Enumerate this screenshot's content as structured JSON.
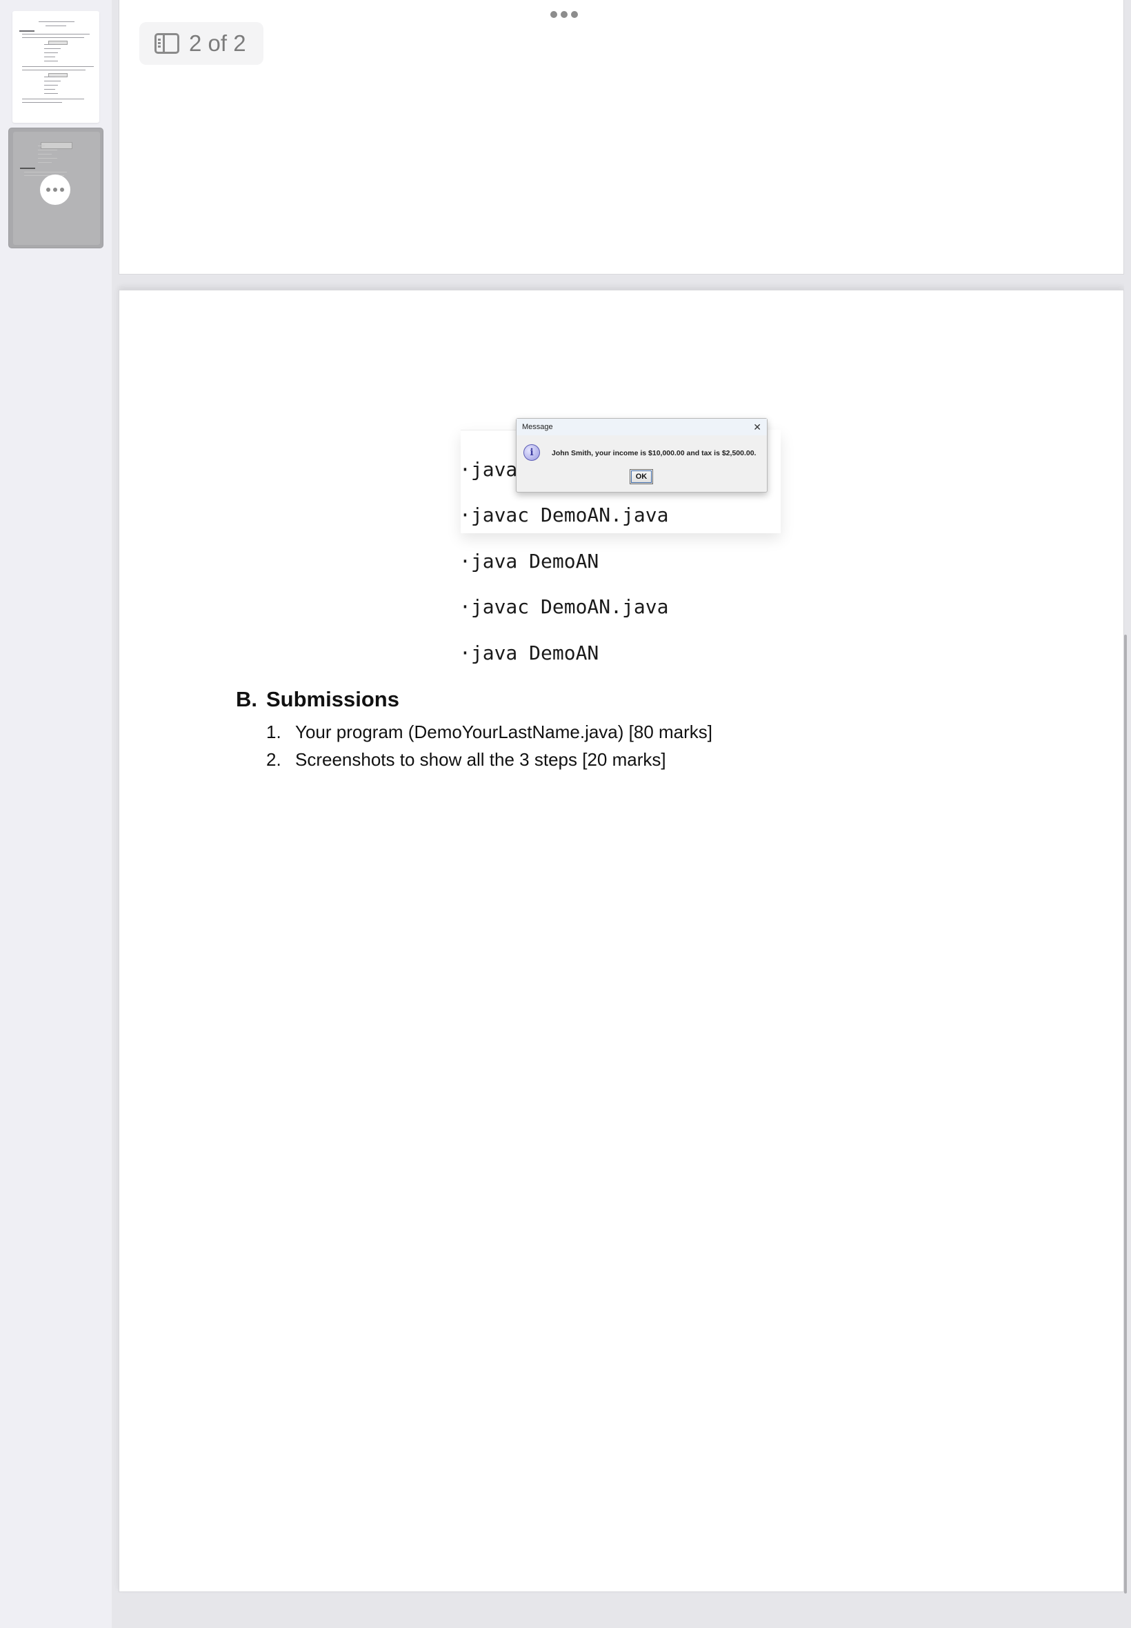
{
  "viewer": {
    "page_indicator": "2 of 2",
    "current_page": 2,
    "total_pages": 2
  },
  "dialog": {
    "title": "Message",
    "close_glyph": "✕",
    "info_glyph": "i",
    "message": "John Smith, your income is $10,000.00 and tax is $2,500.00.",
    "ok_label": "OK"
  },
  "commands": [
    "·java",
    "·javac DemoAN.java",
    "·java DemoAN",
    "·javac DemoAN.java",
    "·java DemoAN"
  ],
  "section": {
    "number": "B.",
    "title": "Submissions",
    "items": [
      {
        "num": "1.",
        "text": "Your program (DemoYourLastName.java) [80 marks]"
      },
      {
        "num": "2.",
        "text": "Screenshots to show all the 3 steps [20 marks]"
      }
    ]
  },
  "icons": {
    "sidebar_toggle": "sidebar-toggle-icon",
    "more": "more-horizontal-icon",
    "info": "info-icon",
    "close": "close-icon"
  }
}
